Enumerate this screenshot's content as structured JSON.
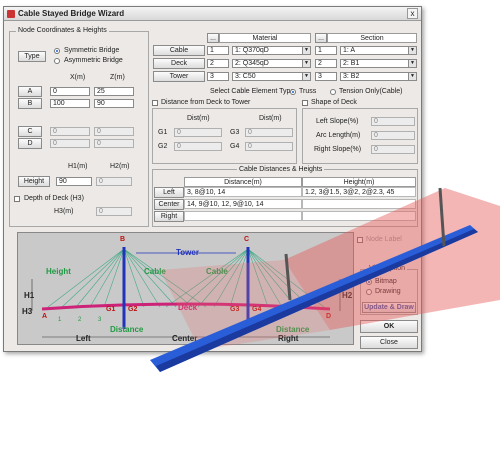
{
  "window": {
    "title": "Cable Stayed Bridge Wizard",
    "close": "x"
  },
  "node_coords": {
    "group_title": "Node Coordinates & Heights",
    "type_label": "Type",
    "opt_symmetric": "Symmetric Bridge",
    "opt_asymmetric": "Asymmetric Bridge",
    "col_x": "X(m)",
    "col_z": "Z(m)",
    "rows": [
      {
        "label": "A",
        "x": "0",
        "z": "25"
      },
      {
        "label": "B",
        "x": "100",
        "z": "90"
      },
      {
        "label": "C",
        "x": "0",
        "z": "0"
      },
      {
        "label": "D",
        "x": "0",
        "z": "0"
      }
    ],
    "col_h1": "H1(m)",
    "col_h2": "H2(m)",
    "height_label": "Height",
    "h1": "90",
    "h2": "0",
    "depth_label": "Depth of Deck (H3)",
    "h3_label": "H3(m)",
    "h3": "0"
  },
  "materials": {
    "header_btn": "...",
    "header_material": "Material",
    "header_btn2": "...",
    "header_section": "Section",
    "rows": [
      {
        "label": "Cable",
        "mat_no": "1",
        "mat": "1: Q370qD",
        "sec_no": "1",
        "sec": "1: A"
      },
      {
        "label": "Deck",
        "mat_no": "2",
        "mat": "2: Q345qD",
        "sec_no": "2",
        "sec": "2: B1"
      },
      {
        "label": "Tower",
        "mat_no": "3",
        "mat": "3: C50",
        "sec_no": "3",
        "sec": "3: B2"
      }
    ]
  },
  "cable_type": {
    "label": "Select Cable Element Type",
    "opt_truss": "Truss",
    "opt_tension": "Tension Only(Cable)"
  },
  "distance": {
    "check_label": "Distance from Deck to Tower",
    "col1": "Dist(m)",
    "col2": "Dist(m)",
    "g1": "G1",
    "g2": "G2",
    "g3": "G3",
    "g4": "G4",
    "v1": "0",
    "v2": "0",
    "v3": "0",
    "v4": "0"
  },
  "shape": {
    "check_label": "Shape of Deck",
    "left_slope": "Left Slope(%)",
    "left_val": "0",
    "arc": "Arc Length(m)",
    "arc_val": "0",
    "right_slope": "Right Slope(%)",
    "right_val": "0"
  },
  "cable_dist": {
    "title": "Cable Distances & Heights",
    "col_dist": "Distance(m)",
    "col_height": "Height(m)",
    "rows": [
      {
        "label": "Left",
        "dist": "3, 8@10, 14",
        "height": "1.2, 3@1.5, 3@2, 2@2.3, 45"
      },
      {
        "label": "Center",
        "dist": "14, 9@10, 12, 9@10, 14",
        "height": ""
      },
      {
        "label": "Right",
        "dist": "",
        "height": ""
      }
    ]
  },
  "diagram": {
    "tower": "Tower",
    "cable_left": "Cable",
    "cable_right": "Cable",
    "height": "Height",
    "deck": "Deck",
    "b": "B",
    "c": "C",
    "a": "A",
    "d": "D",
    "h1": "H1",
    "h3": "H3",
    "h2": "H2",
    "g1": "G1",
    "g2": "G2",
    "g3": "G3",
    "g4": "G4",
    "dist_left": "Distance",
    "dist_right": "Distance",
    "left": "Left",
    "center": "Center",
    "right": "Right",
    "num_1": "1",
    "num_2": "2",
    "num_3": "3"
  },
  "view": {
    "node_label": "Node Label",
    "group_title": "View option",
    "opt_bitmap": "Bitmap",
    "opt_drawing": "Drawing",
    "update_btn": "Update & Draw",
    "ok": "OK",
    "close": "Close"
  }
}
